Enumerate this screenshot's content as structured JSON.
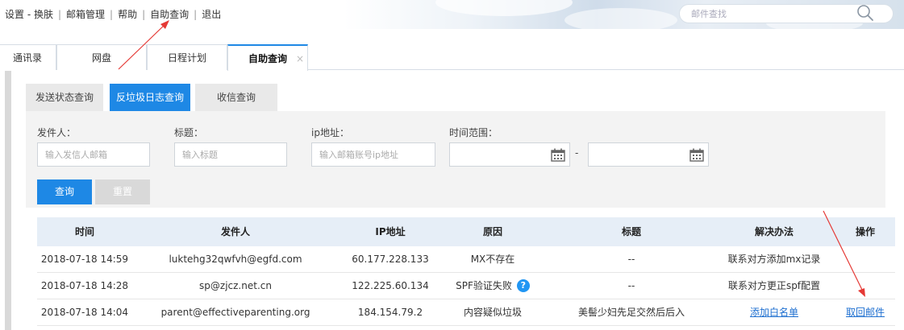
{
  "topnav": {
    "items": [
      "设置 - 换肤",
      "邮箱管理",
      "帮助",
      "自助查询",
      "退出"
    ],
    "separator": "|"
  },
  "search": {
    "placeholder": "邮件查找"
  },
  "tabs": {
    "items": [
      "通讯录",
      "网盘",
      "日程计划",
      "自助查询"
    ],
    "active": "自助查询",
    "close_glyph": "×"
  },
  "subtabs": {
    "items": [
      "发送状态查询",
      "反垃圾日志查询",
      "收信查询"
    ],
    "active": "反垃圾日志查询"
  },
  "filters": {
    "sender": {
      "label": "发件人：",
      "placeholder": "输入发信人邮箱"
    },
    "subject": {
      "label": "标题：",
      "placeholder": "输入标题"
    },
    "ip": {
      "label": "ip地址：",
      "placeholder": "输入邮箱账号ip地址"
    },
    "time_range": {
      "label": "时间范围：",
      "start": "",
      "end": "",
      "separator": "-"
    }
  },
  "buttons": {
    "query": "查询",
    "reset": "重置"
  },
  "table": {
    "headers": [
      "时间",
      "发件人",
      "IP地址",
      "原因",
      "标题",
      "解决办法",
      "操作"
    ],
    "rows": [
      {
        "time": "2018-07-18 14:59",
        "sender": "luktehg32qwfvh@egfd.com",
        "ip": "60.177.228.133",
        "reason": "MX不存在",
        "subject": "--",
        "solution": "联系对方添加mx记录",
        "action": ""
      },
      {
        "time": "2018-07-18 14:28",
        "sender": "sp@zjcz.net.cn",
        "ip": "122.225.60.134",
        "reason": "SPF验证失败",
        "subject": "--",
        "solution": "联系对方更正spf配置",
        "action": ""
      },
      {
        "time": "2018-07-18 14:04",
        "sender": "parent@effectiveparenting.org",
        "ip": "184.154.79.2",
        "reason": "内容疑似垃圾",
        "subject": "美髻少妇先足交然后后入",
        "solution": "添加白名单",
        "action": "取回邮件"
      }
    ]
  },
  "colors": {
    "accent": "#1e88e5",
    "annotation_arrow": "#e53935",
    "header_bg": "#e6eef7",
    "link": "#1e6fd0"
  },
  "icons": {
    "search": "search-icon",
    "calendar": "calendar-icon",
    "help": "help-icon",
    "close": "close-icon"
  }
}
